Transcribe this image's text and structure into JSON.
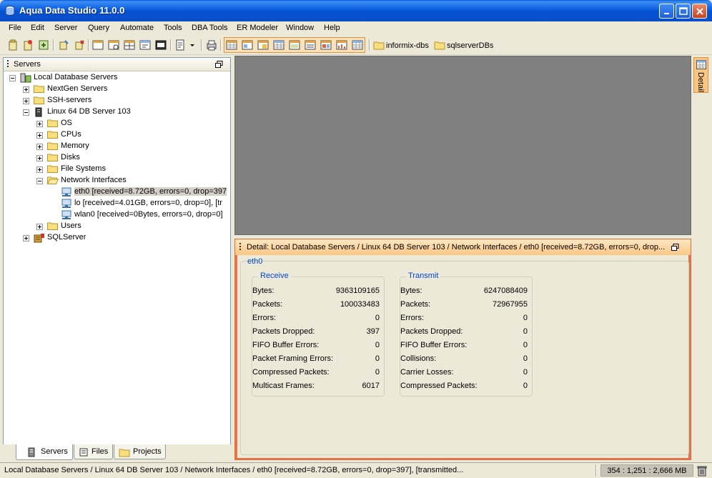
{
  "window": {
    "title": "Aqua Data Studio 11.0.0"
  },
  "menu": [
    "File",
    "Edit",
    "Server",
    "Query",
    "Automate",
    "Tools",
    "DBA Tools",
    "ER Modeler",
    "Window",
    "Help"
  ],
  "toolbar": {
    "folders": [
      "informix-dbs",
      "sqlserverDBs"
    ]
  },
  "servers_panel": {
    "title": "Servers",
    "tree": [
      {
        "label": "Local Database Servers",
        "level": 0,
        "icon": "server-group-icon",
        "expander": "minus"
      },
      {
        "label": "NextGen Servers",
        "level": 1,
        "icon": "folder-icon",
        "expander": "plus"
      },
      {
        "label": "SSH-servers",
        "level": 1,
        "icon": "folder-icon",
        "expander": "plus"
      },
      {
        "label": "Linux 64 DB Server 103",
        "level": 1,
        "icon": "server-icon",
        "expander": "minus"
      },
      {
        "label": "OS",
        "level": 2,
        "icon": "folder-icon",
        "expander": "plus"
      },
      {
        "label": "CPUs",
        "level": 2,
        "icon": "folder-icon",
        "expander": "plus"
      },
      {
        "label": "Memory",
        "level": 2,
        "icon": "folder-icon",
        "expander": "plus"
      },
      {
        "label": "Disks",
        "level": 2,
        "icon": "folder-icon",
        "expander": "plus"
      },
      {
        "label": "File Systems",
        "level": 2,
        "icon": "folder-icon",
        "expander": "plus"
      },
      {
        "label": "Network Interfaces",
        "level": 2,
        "icon": "folder-open-icon",
        "expander": "minus"
      },
      {
        "label": "eth0 [received=8.72GB, errors=0, drop=397",
        "level": 3,
        "icon": "network-interface-icon",
        "expander": "none",
        "selected": true
      },
      {
        "label": "lo [received=4.01GB, errors=0, drop=0], [tr",
        "level": 3,
        "icon": "network-interface-icon",
        "expander": "none"
      },
      {
        "label": "wlan0 [received=0Bytes, errors=0, drop=0]",
        "level": 3,
        "icon": "network-interface-icon",
        "expander": "none"
      },
      {
        "label": "Users",
        "level": 2,
        "icon": "folder-icon",
        "expander": "plus"
      },
      {
        "label": "SQLServer",
        "level": 1,
        "icon": "sqlserver-icon",
        "expander": "plus"
      }
    ]
  },
  "bottom_tabs": [
    "Servers",
    "Files",
    "Projects"
  ],
  "side_tab": "Detail",
  "detail": {
    "header": "Detail: Local Database Servers / Linux 64 DB Server 103 / Network Interfaces / eth0 [received=8.72GB, errors=0, drop...",
    "interface": "eth0",
    "receive": {
      "title": "Receive",
      "rows": [
        {
          "k": "Bytes:",
          "v": "9363109165"
        },
        {
          "k": "Packets:",
          "v": "100033483"
        },
        {
          "k": "Errors:",
          "v": "0"
        },
        {
          "k": "Packets Dropped:",
          "v": "397"
        },
        {
          "k": "FIFO Buffer Errors:",
          "v": "0"
        },
        {
          "k": "Packet Framing Errors:",
          "v": "0"
        },
        {
          "k": "Compressed Packets:",
          "v": "0"
        },
        {
          "k": "Multicast Frames:",
          "v": "6017"
        }
      ]
    },
    "transmit": {
      "title": "Transmit",
      "rows": [
        {
          "k": "Bytes:",
          "v": "6247088409"
        },
        {
          "k": "Packets:",
          "v": "72967955"
        },
        {
          "k": "Errors:",
          "v": "0"
        },
        {
          "k": "Packets Dropped:",
          "v": "0"
        },
        {
          "k": "FIFO Buffer Errors:",
          "v": "0"
        },
        {
          "k": "Collisions:",
          "v": "0"
        },
        {
          "k": "Carrier Losses:",
          "v": "0"
        },
        {
          "k": "Compressed Packets:",
          "v": "0"
        }
      ]
    }
  },
  "statusbar": {
    "path": "Local Database Servers / Linux 64 DB Server 103 / Network Interfaces / eth0 [received=8.72GB, errors=0, drop=397], [transmitted...",
    "memory": "354 : 1,251 : 2,666 MB"
  }
}
